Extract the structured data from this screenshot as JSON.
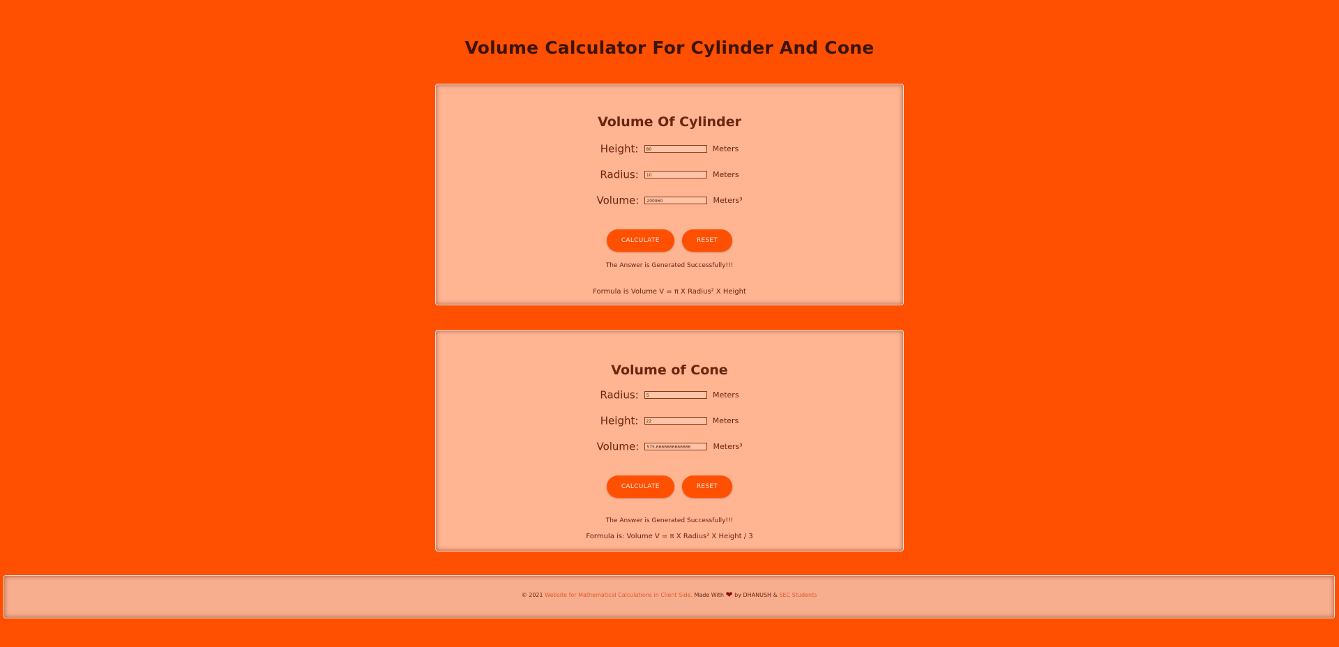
{
  "page": {
    "title": "Volume Calculator For Cylinder And Cone"
  },
  "cylinder": {
    "title": "Volume Of Cylinder",
    "fields": [
      {
        "label": "Height:",
        "value": "80",
        "unit": "Meters"
      },
      {
        "label": "Radius:",
        "value": "10",
        "unit": "Meters"
      },
      {
        "label": "Volume:",
        "value": "200960",
        "unit": "Meters³"
      }
    ],
    "calculate_label": "CALCULATE",
    "reset_label": "RESET",
    "status": "The Answer is Generated Successfully!!!",
    "formula": "Formula is Volume V = π X Radius² X Height"
  },
  "cone": {
    "title": "Volume of Cone",
    "fields": [
      {
        "label": "Radius:",
        "value": "5",
        "unit": "Meters"
      },
      {
        "label": "Height:",
        "value": "22",
        "unit": "Meters"
      },
      {
        "label": "Volume:",
        "value": "575.6666666666666",
        "unit": "Meters³"
      }
    ],
    "calculate_label": "CALCULATE",
    "reset_label": "RESET",
    "status": "The Answer is Generated Successfully!!!",
    "formula": "Formula is: Volume V = π X Radius² X Height / 3"
  },
  "footer": {
    "copyright": "© 2021",
    "site_link": "Website for Mathematical Calculations in Client Side.",
    "made_with": "Made With",
    "heart": "❤",
    "by_text": "by DHANUSH &",
    "students_link": "SEC Students"
  },
  "corner_mark": "..."
}
